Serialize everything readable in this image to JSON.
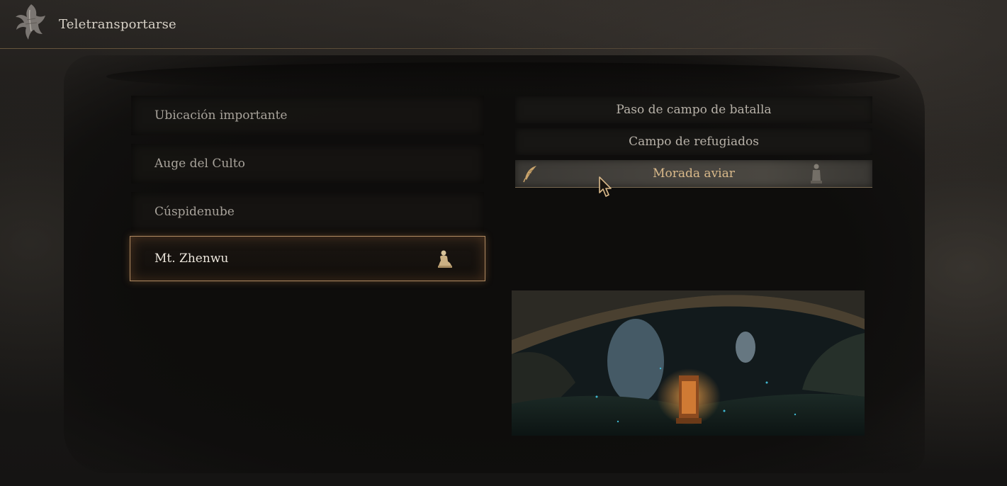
{
  "header": {
    "title": "Teletransportarse",
    "emblem_icon": "phoenix-emblem-icon"
  },
  "regions": [
    {
      "label": "Ubicación importante",
      "selected": false
    },
    {
      "label": "Auge del Culto",
      "selected": false
    },
    {
      "label": "Cúspidenube",
      "selected": false
    },
    {
      "label": "Mt. Zhenwu",
      "selected": true,
      "icon": "shrine-statue-icon"
    }
  ],
  "locations": [
    {
      "label": "Paso de campo de batalla",
      "highlighted": false
    },
    {
      "label": "Campo de refugiados",
      "highlighted": false
    },
    {
      "label": "Morada aviar",
      "highlighted": true,
      "left_icon": "feather-icon",
      "right_icon": "statue-icon"
    }
  ],
  "preview": {
    "scene": "cave-shrine-preview-image"
  },
  "colors": {
    "accent_gold": "#d9b98a",
    "selected_border": "#b08a62",
    "text_normal": "#a8a39b"
  }
}
